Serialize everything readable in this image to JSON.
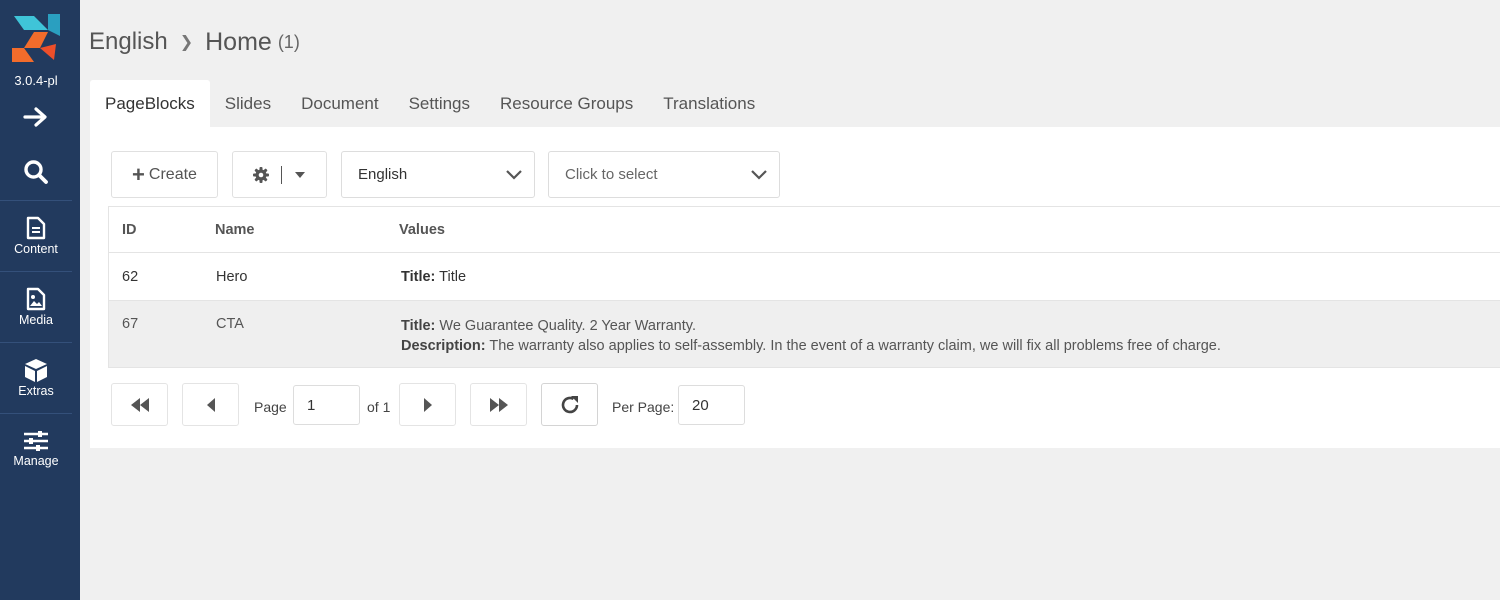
{
  "sidebar": {
    "version": "3.0.4-pl",
    "items": [
      {
        "label": "Content"
      },
      {
        "label": "Media"
      },
      {
        "label": "Extras"
      },
      {
        "label": "Manage"
      }
    ]
  },
  "breadcrumb": {
    "parent": "English",
    "current": "Home",
    "count": "(1)"
  },
  "tabs": [
    {
      "label": "PageBlocks"
    },
    {
      "label": "Slides"
    },
    {
      "label": "Document"
    },
    {
      "label": "Settings"
    },
    {
      "label": "Resource Groups"
    },
    {
      "label": "Translations"
    }
  ],
  "toolbar": {
    "create_label": "Create",
    "language_value": "English",
    "context_placeholder": "Click to select"
  },
  "grid": {
    "columns": [
      "ID",
      "Name",
      "Values"
    ],
    "rows": [
      {
        "id": "62",
        "name": "Hero",
        "values": [
          {
            "key": "Title:",
            "value": "Title"
          }
        ]
      },
      {
        "id": "67",
        "name": "CTA",
        "values": [
          {
            "key": "Title:",
            "value": "We Guarantee Quality. 2 Year Warranty."
          },
          {
            "key": "Description:",
            "value": "The warranty also applies to self-assembly. In the event of a warranty claim, we will fix all problems free of charge."
          }
        ]
      }
    ]
  },
  "pagination": {
    "page_label": "Page",
    "page_value": "1",
    "of_label": "of 1",
    "per_page_label": "Per Page:",
    "per_page_value": "20"
  },
  "colors": {
    "sidebar": "#223a5e",
    "logo_teal": "#2bb6c9",
    "logo_orange": "#f0632a"
  }
}
